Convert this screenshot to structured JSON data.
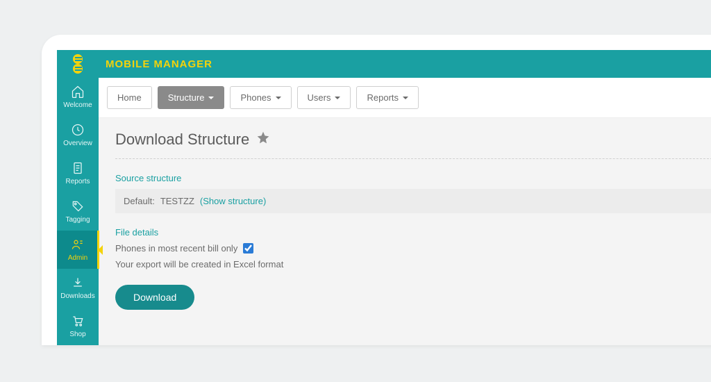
{
  "brand": {
    "title": "MOBILE MANAGER"
  },
  "sidebar": {
    "items": [
      {
        "label": "Welcome"
      },
      {
        "label": "Overview"
      },
      {
        "label": "Reports"
      },
      {
        "label": "Tagging"
      },
      {
        "label": "Admin"
      },
      {
        "label": "Downloads"
      },
      {
        "label": "Shop"
      }
    ]
  },
  "tabs": {
    "home": "Home",
    "structure": "Structure",
    "phones": "Phones",
    "users": "Users",
    "reports": "Reports"
  },
  "page": {
    "title": "Download Structure",
    "source_head": "Source structure",
    "default_label": "Default:",
    "default_value": "TESTZZ",
    "show_link": "(Show structure)",
    "file_head": "File details",
    "checkbox_label": "Phones in most recent bill only",
    "export_note": "Your export will be created in Excel format",
    "download_btn": "Download"
  }
}
